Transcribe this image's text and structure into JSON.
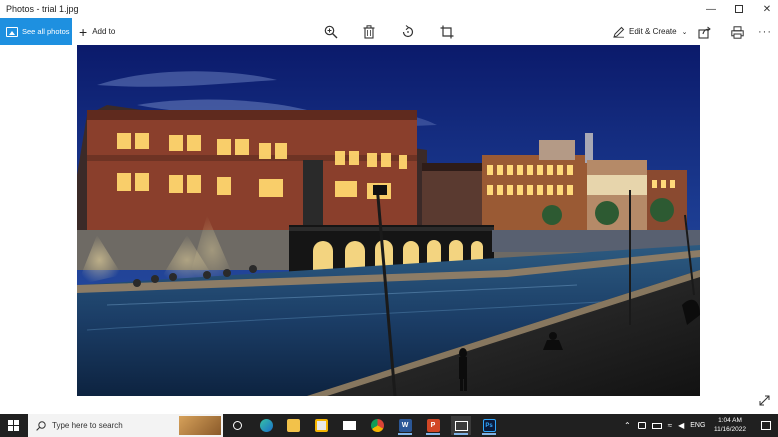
{
  "window": {
    "title": "Photos - trial 1.jpg"
  },
  "toolbar": {
    "see_all_label": "See all photos",
    "add_to_label": "Add to",
    "edit_create_label": "Edit & Create"
  },
  "taskbar": {
    "search_placeholder": "Type here to search",
    "word_badge": "W",
    "ppt_badge": "P",
    "ps_badge": "Ps",
    "language": "ENG",
    "time": "1:04 AM",
    "date": "11/16/2022"
  },
  "colors": {
    "accent": "#1e90e0",
    "taskbar": "#202020",
    "sky_top": "#0b1a6b",
    "water": "#1b3d66"
  }
}
